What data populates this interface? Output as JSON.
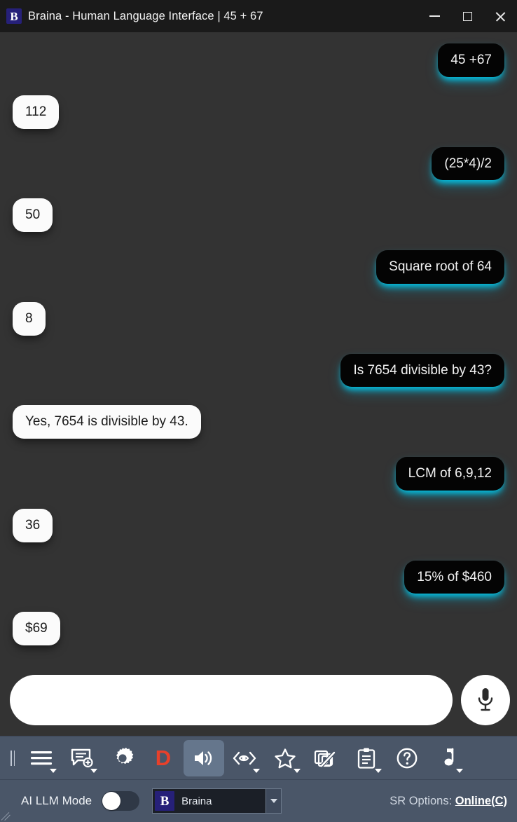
{
  "window": {
    "app_icon": "braina-logo-icon",
    "title": "Braina - Human Language Interface | 45 + 67",
    "logo_letter": "B",
    "controls": {
      "minimize": "minimize-icon",
      "maximize": "maximize-icon",
      "close": "close-icon"
    }
  },
  "conversation": [
    {
      "role": "user",
      "text": "45 +67"
    },
    {
      "role": "bot",
      "text": "112"
    },
    {
      "role": "user",
      "text": "(25*4)/2"
    },
    {
      "role": "bot",
      "text": "50"
    },
    {
      "role": "user",
      "text": "Square root of 64"
    },
    {
      "role": "bot",
      "text": "8"
    },
    {
      "role": "user",
      "text": "Is 7654 divisible by 43?"
    },
    {
      "role": "bot",
      "text": "Yes, 7654 is divisible by 43."
    },
    {
      "role": "user",
      "text": "LCM of 6,9,12"
    },
    {
      "role": "bot",
      "text": "36"
    },
    {
      "role": "user",
      "text": "15% of $460"
    },
    {
      "role": "bot",
      "text": "$69"
    }
  ],
  "composer": {
    "input_value": "",
    "input_placeholder": "",
    "mic_icon": "microphone-icon"
  },
  "toolbar": {
    "items": [
      {
        "name": "drag-handle",
        "icon": "grip-icon",
        "caret": false,
        "active": false
      },
      {
        "name": "menu-button",
        "icon": "hamburger-menu-icon",
        "caret": true,
        "active": false
      },
      {
        "name": "new-chat-button",
        "icon": "new-chat-icon",
        "caret": true,
        "active": false
      },
      {
        "name": "settings-button",
        "icon": "gear-icon",
        "caret": false,
        "active": false
      },
      {
        "name": "dictation-button",
        "icon": "letter-d-icon",
        "caret": false,
        "active": false,
        "label": "D"
      },
      {
        "name": "speaker-button",
        "icon": "speaker-volume-icon",
        "caret": false,
        "active": true
      },
      {
        "name": "vision-button",
        "icon": "eye-vision-icon",
        "caret": true,
        "active": false
      },
      {
        "name": "favorites-button",
        "icon": "star-icon",
        "caret": true,
        "active": false
      },
      {
        "name": "screen-capture-button",
        "icon": "copy-disabled-icon",
        "caret": false,
        "active": false
      },
      {
        "name": "notes-button",
        "icon": "clipboard-icon",
        "caret": true,
        "active": false
      },
      {
        "name": "help-button",
        "icon": "question-circle-icon",
        "caret": false,
        "active": false
      },
      {
        "name": "music-button",
        "icon": "music-note-icon",
        "caret": true,
        "active": false
      }
    ]
  },
  "statusbar": {
    "ai_mode_label": "AI LLM Mode",
    "ai_mode_on": false,
    "model": {
      "icon": "braina-logo-icon",
      "logo_letter": "B",
      "selected": "Braina"
    },
    "sr_prefix": "SR Options: ",
    "sr_value": "Online(C)"
  },
  "colors": {
    "titlebar_bg": "#1a1a1a",
    "chat_bg": "#333333",
    "toolbar_bg": "#4a5668",
    "toolbar_active": "#65768c",
    "user_bubble_bg": "#040404",
    "user_bubble_glow": "#00c8eb",
    "bot_bubble_bg": "#fbfbfb",
    "accent_red": "#e8402a",
    "logo_blue": "#262079"
  }
}
